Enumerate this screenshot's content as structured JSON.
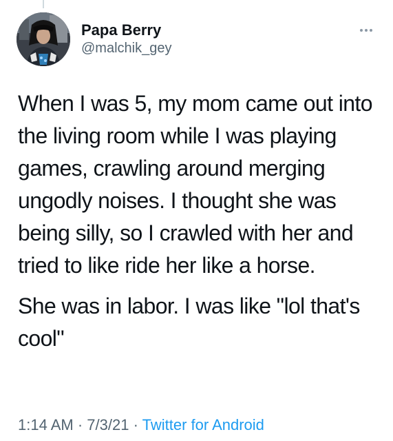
{
  "tweet": {
    "author": {
      "display_name": "Papa Berry",
      "handle": "@malchik_gey",
      "avatar_icon": "profile-photo"
    },
    "more_icon": "more-options-icon",
    "text_paragraphs": [
      "When I was 5, my mom came out into the living room while I was playing games, crawling around merging ungodly noises. I thought she was being silly, so I crawled with her and tried to like ride her like a horse.",
      "She was in labor. I was like \"lol that's cool\""
    ],
    "meta": {
      "time": "1:14 AM",
      "separator": " · ",
      "date": "7/3/21",
      "source": "Twitter for Android"
    }
  },
  "colors": {
    "text": "#0f1419",
    "secondary": "#536471",
    "link": "#1d9bf0"
  }
}
